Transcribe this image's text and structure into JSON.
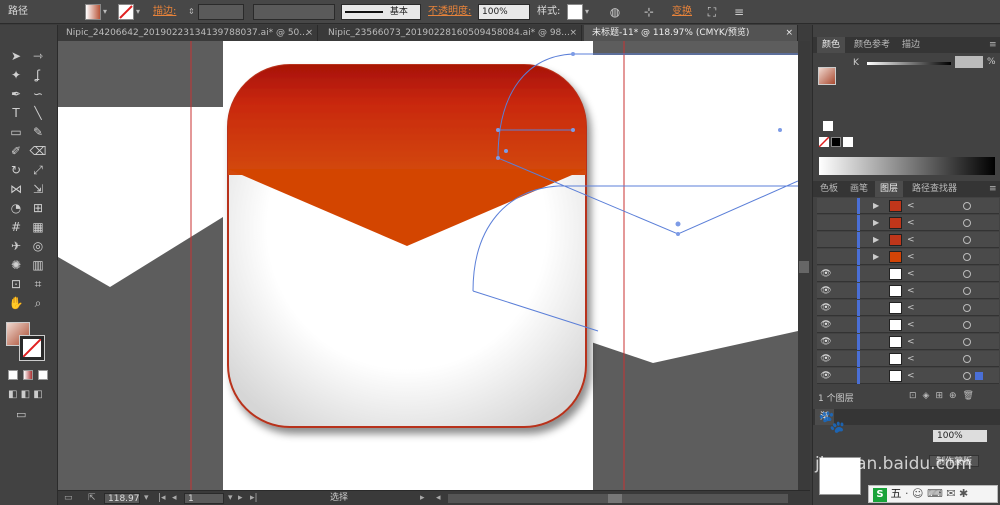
{
  "control_bar": {
    "object_type": "路径",
    "stroke_label": "描边:",
    "stroke_profile": "基本",
    "opacity_label": "不透明度:",
    "opacity_value": "100%",
    "style_label": "样式:",
    "transform_label": "变换"
  },
  "tabs": [
    {
      "label": "Nipic_24206642_20190223134139788037.ai* @ 50...",
      "active": false
    },
    {
      "label": "Nipic_23566073_20190228160509458084.ai* @ 98...",
      "active": false
    },
    {
      "label": "未标题-11* @ 118.97% (CMYK/预览)",
      "active": true
    }
  ],
  "tools": [
    "selection-arrow",
    "direct-selection-arrow",
    "magic-wand",
    "lasso",
    "pen",
    "curvature",
    "type",
    "line-segment",
    "rectangle",
    "paintbrush",
    "pencil",
    "eraser",
    "rotate",
    "scale",
    "width",
    "free-transform",
    "shape-builder",
    "perspective-grid",
    "mesh",
    "gradient",
    "eyedropper",
    "blend",
    "symbol-sprayer",
    "column-graph",
    "artboard",
    "slice",
    "hand",
    "zoom"
  ],
  "status_bar": {
    "zoom": "118.97",
    "artboard_number": "1",
    "status_text": "选择"
  },
  "color_panel": {
    "tabs": [
      "颜色",
      "颜色参考",
      "描边"
    ],
    "channel_label": "K",
    "channel_unit": "%"
  },
  "layers_panel": {
    "tabs": [
      "色板",
      "画笔",
      "图层",
      "路径查找器"
    ],
    "footer_label": "1 个图层"
  },
  "transparency_panel": {
    "tab_label": "渐",
    "opacity_value": "100%",
    "make_mask_label": "制作蒙版"
  },
  "watermark": {
    "text": "jingyan.baidu.com"
  },
  "taskbar": {
    "ime_label": "五"
  },
  "colors": {
    "accent": "#e8833a",
    "envelope_top": "#c42a08",
    "envelope_flap": "#d34406",
    "envelope_border": "#b8321a",
    "guide_line": "#c83232",
    "path_selection": "#5b7fd8"
  }
}
